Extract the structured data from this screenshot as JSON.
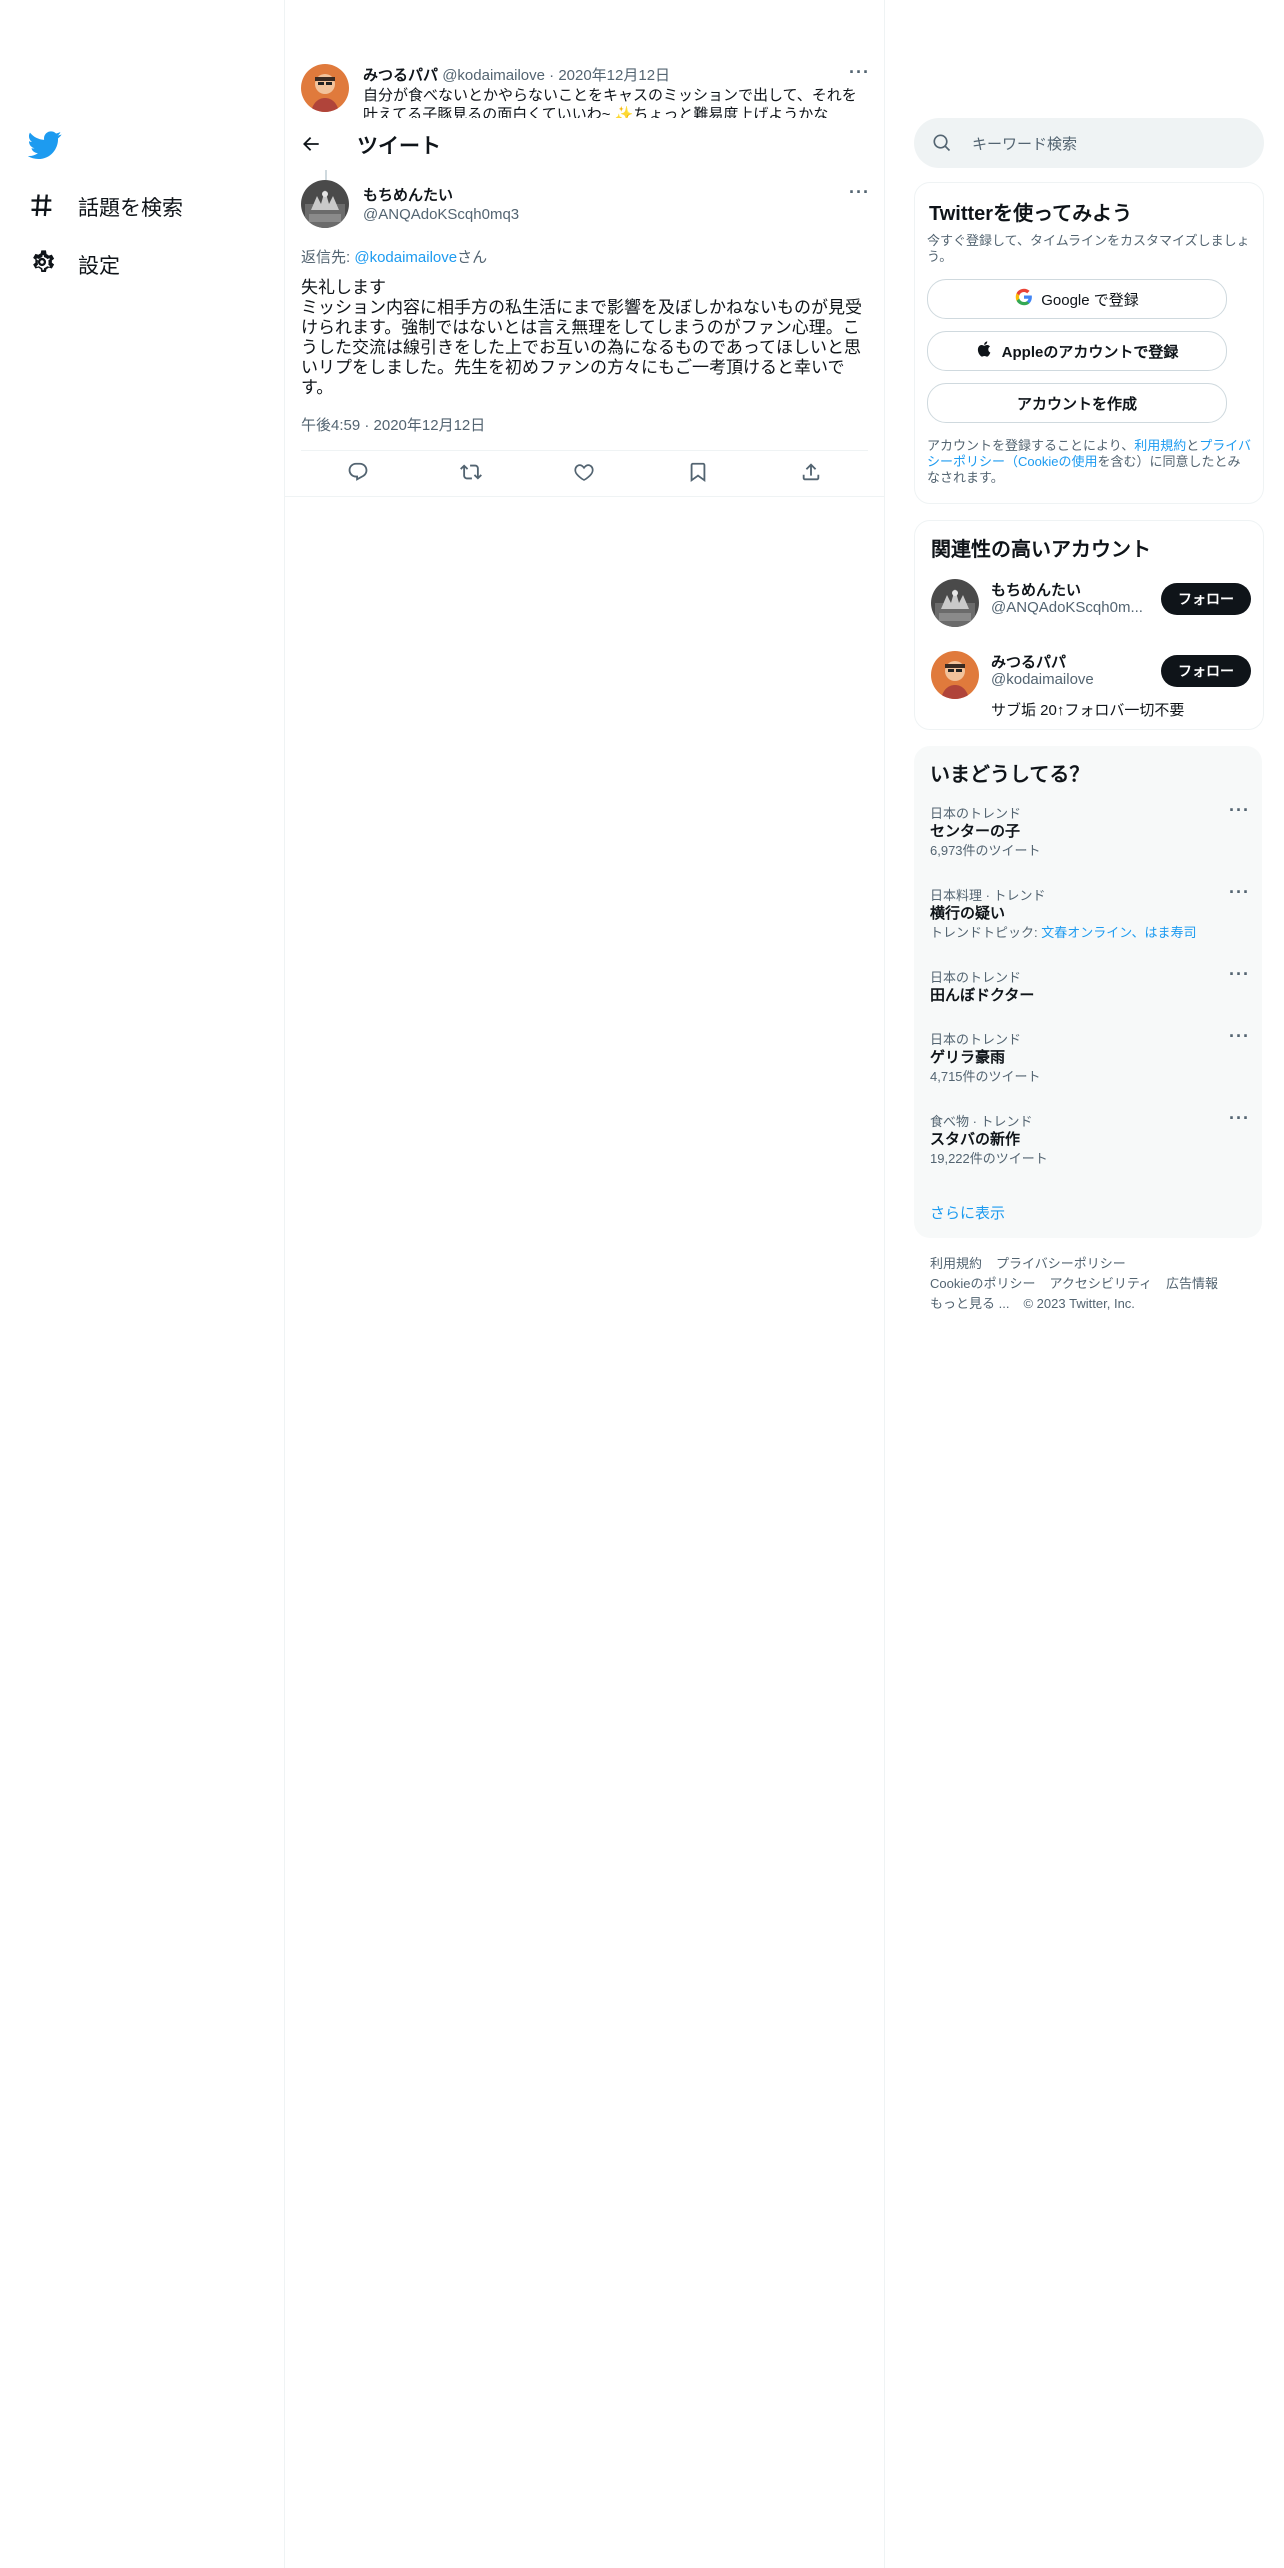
{
  "nav": {
    "explore_label": "話題を検索",
    "settings_label": "設定"
  },
  "parent_tweet": {
    "name": "みつるパパ",
    "handle": "@kodaimailove",
    "date": "2020年12月12日",
    "text": "自分が食べないとかやらないことをキャスのミッションで出して、それを叶えてる子豚見るの面白くていいわ~ ✨ちょっと難易度上げようかな"
  },
  "header": {
    "title": "ツイート"
  },
  "tweet": {
    "name": "もちめんたい",
    "handle": "@ANQAdoKScqh0mq3",
    "reply_prefix": "返信先: ",
    "reply_handle": "@kodaimailove",
    "reply_suffix": "さん",
    "text": "失礼します\nミッション内容に相手方の私生活にまで影響を及ぼしかねないものが見受けられます。強制ではないとは言え無理をしてしまうのがファン心理。こうした交流は線引きをした上でお互いの為になるものであってほしいと思いリプをしました。先生を初めファンの方々にもご一考頂けると幸いです。",
    "timestamp": "午後4:59 · 2020年12月12日"
  },
  "search": {
    "placeholder": "キーワード検索"
  },
  "signup": {
    "title": "Twitterを使ってみよう",
    "subtitle": "今すぐ登録して、タイムラインをカスタマイズしましょう。",
    "google_label": "Google で登録",
    "apple_label": "Appleのアカウントで登録",
    "create_label": "アカウントを作成",
    "legal_prefix": "アカウントを登録することにより、",
    "legal_terms": "利用規約",
    "legal_and": "と",
    "legal_privacy": "プライバシーポリシー（Cookieの使用",
    "legal_suffix": "を含む）に同意したとみなされます。"
  },
  "relevant": {
    "title": "関連性の高いアカウント",
    "accounts": [
      {
        "name": "もちめんたい",
        "handle": "@ANQAdoKScqh0m...",
        "follow": "フォロー"
      },
      {
        "name": "みつるパパ",
        "handle": "@kodaimailove",
        "bio": "サブ垢 20↑フォロバ一切不要",
        "follow": "フォロー"
      }
    ]
  },
  "trends": {
    "title": "いまどうしてる？",
    "items": [
      {
        "context": "日本のトレンド",
        "title": "センターの子",
        "count": "6,973件のツイート"
      },
      {
        "context": "日本料理 · トレンド",
        "title": "横行の疑い",
        "topic_prefix": "トレンドトピック: ",
        "topic_links": "文春オンライン、はま寿司"
      },
      {
        "context": "日本のトレンド",
        "title": "田んぼドクター"
      },
      {
        "context": "日本のトレンド",
        "title": "ゲリラ豪雨",
        "count": "4,715件のツイート"
      },
      {
        "context": "食べ物 · トレンド",
        "title": "スタバの新作",
        "count": "19,222件のツイート"
      }
    ],
    "show_more": "さらに表示"
  },
  "footer": {
    "terms": "利用規約",
    "privacy": "プライバシーポリシー",
    "cookie": "Cookieのポリシー",
    "accessibility": "アクセシビリティ",
    "ads": "広告情報",
    "more": "もっと見る ...",
    "copyright": "© 2023 Twitter, Inc."
  },
  "colors": {
    "accent": "#1d9bf0",
    "text": "#0f1419",
    "muted": "#536471",
    "border": "#eff3f4"
  }
}
